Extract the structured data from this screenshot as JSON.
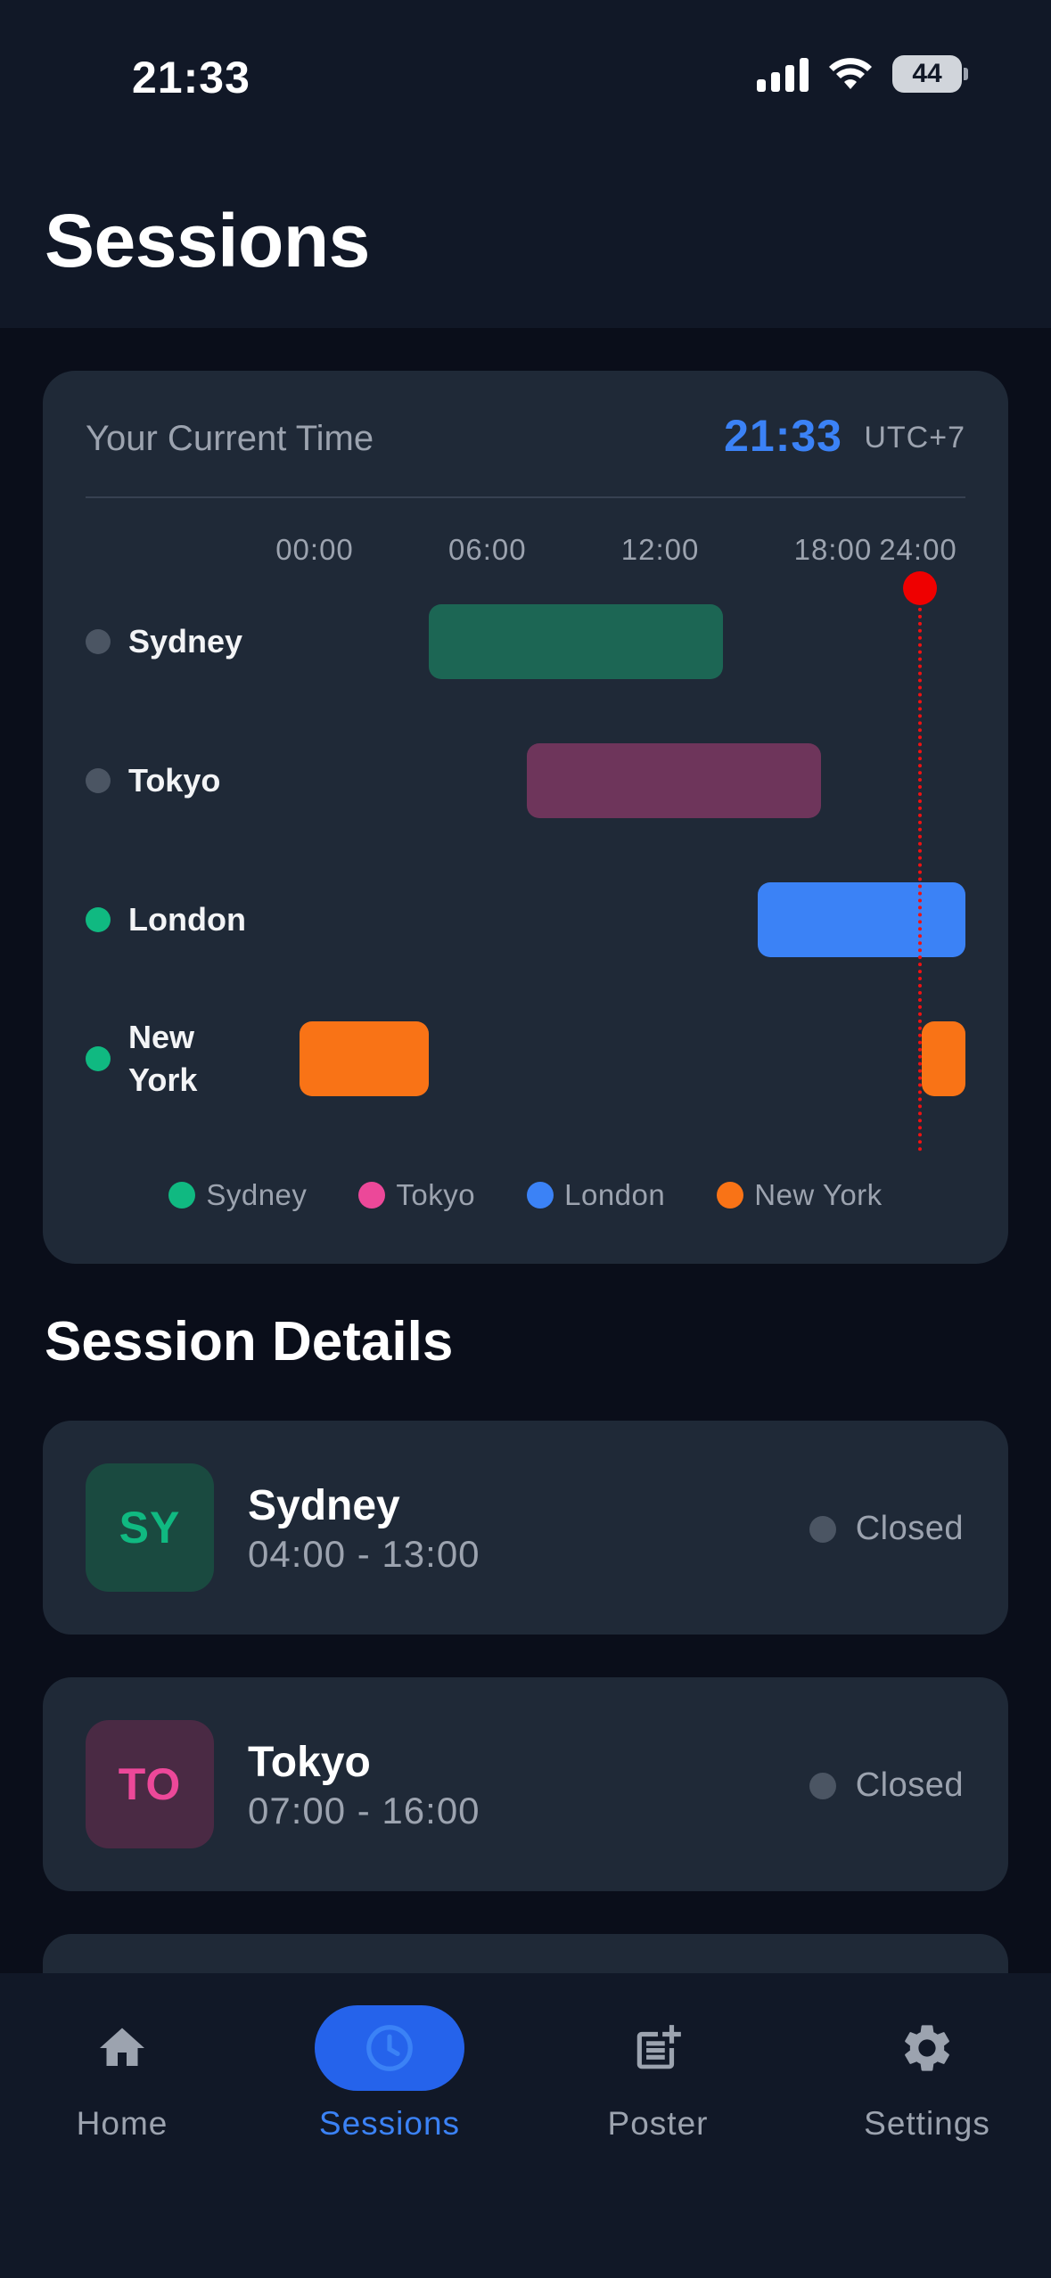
{
  "status_bar": {
    "time": "21:33",
    "battery": "44"
  },
  "page": {
    "title": "Sessions"
  },
  "current_time_card": {
    "label": "Your Current Time",
    "time": "21:33",
    "timezone": "UTC+7"
  },
  "timeline": {
    "ticks": [
      "00:00",
      "06:00",
      "12:00",
      "18:00",
      "24:00"
    ],
    "current_hour": 21.55,
    "rows": [
      {
        "name": "Sydney",
        "active": false,
        "color": "#1c6654",
        "segments": [
          [
            4.5,
            14.7
          ]
        ]
      },
      {
        "name": "Tokyo",
        "active": false,
        "color": "#6e355b",
        "segments": [
          [
            7.9,
            18.1
          ]
        ]
      },
      {
        "name": "London",
        "active": true,
        "color": "#3b82f6",
        "segments": [
          [
            15.9,
            26.1
          ]
        ]
      },
      {
        "name": "New York",
        "active": true,
        "color": "#f97316",
        "segments": [
          [
            0,
            4.5
          ],
          [
            21.6,
            27.3
          ]
        ]
      }
    ],
    "status_colors": {
      "active": "#10b981",
      "inactive": "#4b5563"
    },
    "legend": [
      {
        "label": "Sydney",
        "color": "#10b981"
      },
      {
        "label": "Tokyo",
        "color": "#ec4899"
      },
      {
        "label": "London",
        "color": "#3b82f6"
      },
      {
        "label": "New York",
        "color": "#f97316"
      }
    ]
  },
  "session_details": {
    "title": "Session Details",
    "sessions": [
      {
        "abbr": "SY",
        "name": "Sydney",
        "hours": "04:00 - 13:00",
        "status": "Closed",
        "badge_bg": "#1a4a40",
        "badge_fg": "#10b981"
      },
      {
        "abbr": "TO",
        "name": "Tokyo",
        "hours": "07:00 - 16:00",
        "status": "Closed",
        "badge_bg": "#4a2a44",
        "badge_fg": "#ec4899"
      }
    ]
  },
  "nav": {
    "items": [
      {
        "label": "Home",
        "icon": "home-icon",
        "active": false
      },
      {
        "label": "Sessions",
        "icon": "clock-icon",
        "active": true
      },
      {
        "label": "Poster",
        "icon": "post-add-icon",
        "active": false
      },
      {
        "label": "Settings",
        "icon": "gear-icon",
        "active": false
      }
    ]
  }
}
